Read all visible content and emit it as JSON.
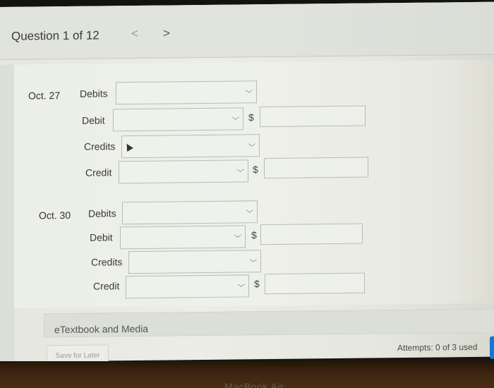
{
  "header": {
    "title": "Question 1 of 12",
    "prev_icon": "chevron-left-icon",
    "next_icon": "chevron-right-icon",
    "prev_glyph": "<",
    "next_glyph": ">"
  },
  "entries": [
    {
      "date": "Oct. 27",
      "debits_label": "Debits",
      "debits_value": "",
      "debit_label": "Debit",
      "debit_account": "",
      "debit_amount": "",
      "credits_label": "Credits",
      "credits_value": "",
      "credit_label": "Credit",
      "credit_account": "",
      "credit_amount": ""
    },
    {
      "date": "Oct. 30",
      "debits_label": "Debits",
      "debits_value": "",
      "debit_label": "Debit",
      "debit_account": "",
      "debit_amount": "",
      "credits_label": "Credits",
      "credits_value": "",
      "credit_label": "Credit",
      "credit_account": "",
      "credit_amount": ""
    }
  ],
  "currency_symbol": "$",
  "chevron_glyph": "⌵",
  "footer": {
    "etextbook_label": "eTextbook and Media",
    "save_label": "Save for Later",
    "attempts": "Attempts: 0 of 3 used"
  },
  "device": {
    "brand": "MacBook Air"
  },
  "colors": {
    "submit_accent": "#1b73d2"
  }
}
